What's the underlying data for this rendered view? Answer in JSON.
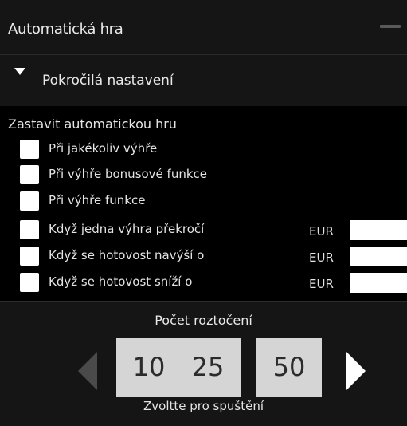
{
  "window": {
    "title": "Automatická hra"
  },
  "advanced": {
    "label": "Pokročilá nastavení"
  },
  "stop": {
    "heading": "Zastavit automatickou hru",
    "options": [
      {
        "label": "Při jakékoliv výhře",
        "checked": false
      },
      {
        "label": "Při výhře bonusové funkce",
        "checked": false
      },
      {
        "label": "Při výhře funkce",
        "checked": false
      },
      {
        "label": "Když jedna výhra překročí",
        "checked": false,
        "currency": "EUR",
        "value": ""
      },
      {
        "label": "Když se hotovost navýší o",
        "checked": false,
        "currency": "EUR",
        "value": ""
      },
      {
        "label": "Když se hotovost sníží o",
        "checked": false,
        "currency": "EUR",
        "value": ""
      }
    ]
  },
  "spins": {
    "title": "Počet roztočení",
    "options": [
      "10",
      "25",
      "50"
    ],
    "hint": "Zvoltte pro spuštění"
  },
  "icons": {
    "minimize": "minimize-icon",
    "expand": "triangle-down-icon",
    "prev": "arrow-left-icon",
    "next": "arrow-right-icon"
  },
  "colors": {
    "panel_bg": "#151515",
    "page_bg": "#000000",
    "button_bg": "#d5d5d5",
    "disabled_arrow": "#4a4a4a"
  }
}
